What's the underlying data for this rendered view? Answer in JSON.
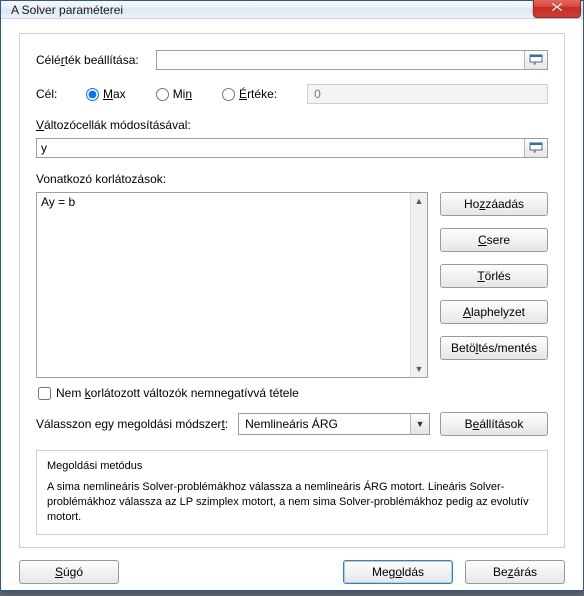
{
  "window": {
    "title": "A Solver paraméterei"
  },
  "objective": {
    "label_pre": "Célé",
    "label_u": "r",
    "label_post": "ték beállítása:",
    "value": ""
  },
  "target": {
    "label": "Cél:",
    "max_u": "M",
    "max_post": "ax",
    "min_pre": "Mi",
    "min_u": "n",
    "val_u": "É",
    "val_post": "rtéke:",
    "value_of": "0"
  },
  "vars": {
    "label_u": "V",
    "label_post": "áltozócellák módosításával:",
    "value": "y"
  },
  "constraints": {
    "label": "Vonatkozó korlátozások:",
    "items": [
      "Ay = b"
    ]
  },
  "buttons": {
    "add_pre": "Ho",
    "add_u": "z",
    "add_post": "záadás",
    "change_u": "C",
    "change_post": "sere",
    "delete_u": "T",
    "delete_post": "örlés",
    "reset_u": "A",
    "reset_post": "laphelyzet",
    "loadsave_pre": "Betö",
    "loadsave_u": "l",
    "loadsave_post": "tés/mentés",
    "options_pre": "B",
    "options_u": "e",
    "options_post": "állítások",
    "help_u": "S",
    "help_post": "úgó",
    "solve_pre": "Meg",
    "solve_u": "o",
    "solve_post": "ldás",
    "close_pre": "Be",
    "close_u": "z",
    "close_post": "árás"
  },
  "nonneg": {
    "pre": "Nem ",
    "u": "k",
    "post": "orlátozott változók nemnegatívvá tétele"
  },
  "method": {
    "label_pre": "Válasszon egy megoldási módszer",
    "label_u": "t",
    "label_post": ":",
    "selected": "Nemlineáris ÁRG"
  },
  "info": {
    "header": "Megoldási metódus",
    "body": "A sima nemlineáris Solver-problémákhoz válassza a nemlineáris ÁRG motort. Lineáris Solver-problémákhoz válassza az LP szimplex motort, a nem sima Solver-problémákhoz pedig az evolutív motort."
  }
}
